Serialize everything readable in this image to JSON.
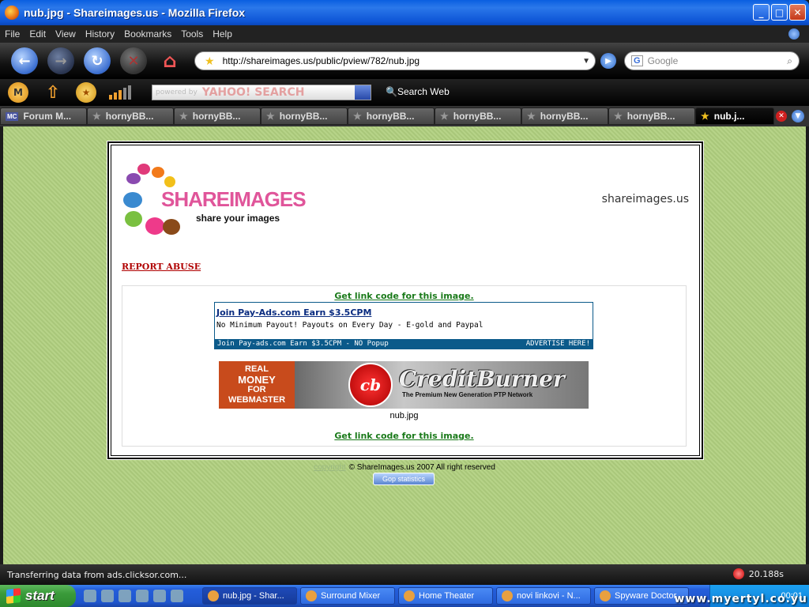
{
  "window": {
    "title": "nub.jpg - Shareimages.us - Mozilla Firefox",
    "controls": {
      "minimize": "_",
      "maximize": "□",
      "close": "✕"
    }
  },
  "menu": [
    "File",
    "Edit",
    "View",
    "History",
    "Bookmarks",
    "Tools",
    "Help"
  ],
  "nav": {
    "url": "http://shareimages.us/public/pview/782/nub.jpg",
    "search_placeholder": "Google"
  },
  "yahoo": {
    "search_placeholder": "powered by",
    "logo": "YAHOO! SEARCH",
    "search_web": "Search Web"
  },
  "tabs": [
    {
      "label": "Forum M...",
      "favicon": "MC"
    },
    {
      "label": "hornyBB..."
    },
    {
      "label": "hornyBB..."
    },
    {
      "label": "hornyBB..."
    },
    {
      "label": "hornyBB..."
    },
    {
      "label": "hornyBB..."
    },
    {
      "label": "hornyBB..."
    },
    {
      "label": "hornyBB..."
    },
    {
      "label": "nub.j...",
      "active": true
    }
  ],
  "page": {
    "logo_text": "SHAREIMAGES",
    "logo_tagline": "share your images",
    "site_name": "shareimages.us",
    "report_abuse": "REPORT ABUSE",
    "link_code_top": "Get link code for this image.",
    "link_code_bottom": "Get link code for this image.",
    "ad": {
      "headline": "Join Pay-Ads.com Earn $3.5CPM",
      "description": "No Minimum Payout! Payouts on Every Day - E-gold and Paypal",
      "footer_left": "Join Pay-ads.com Earn $3.5CPM - NO Popup",
      "footer_right": "ADVERTISE HERE!"
    },
    "banner": {
      "left_lines": [
        "REAL",
        "MONEY",
        "FOR",
        "WEBMASTER"
      ],
      "badge": "cb",
      "brand": "CreditBurner",
      "tagline": "The Premium New Generation PTP Network"
    },
    "filename": "nub.jpg",
    "copyright_link": "copyright",
    "copyright_text": "© ShareImages.us 2007 All right reserved",
    "stats_badge": "Gop statistics"
  },
  "status": {
    "text": "Transferring data from ads.clicksor.com...",
    "timer": "20.188s"
  },
  "taskbar": {
    "start": "start",
    "tasks": [
      {
        "label": "nub.jpg - Shar...",
        "active": true
      },
      {
        "label": "Surround Mixer"
      },
      {
        "label": "Home Theater"
      },
      {
        "label": "novi linkovi - N..."
      },
      {
        "label": "Spyware Doctor"
      }
    ],
    "clock": "00:01"
  },
  "watermark": "www.myertyl.co.yu",
  "colors": {
    "content_bg": "#b0cd82",
    "report_red": "#b00000",
    "link_green": "#1a7a1a",
    "ad_blue": "#0b5a8a",
    "logo_pink": "#e0559a"
  }
}
